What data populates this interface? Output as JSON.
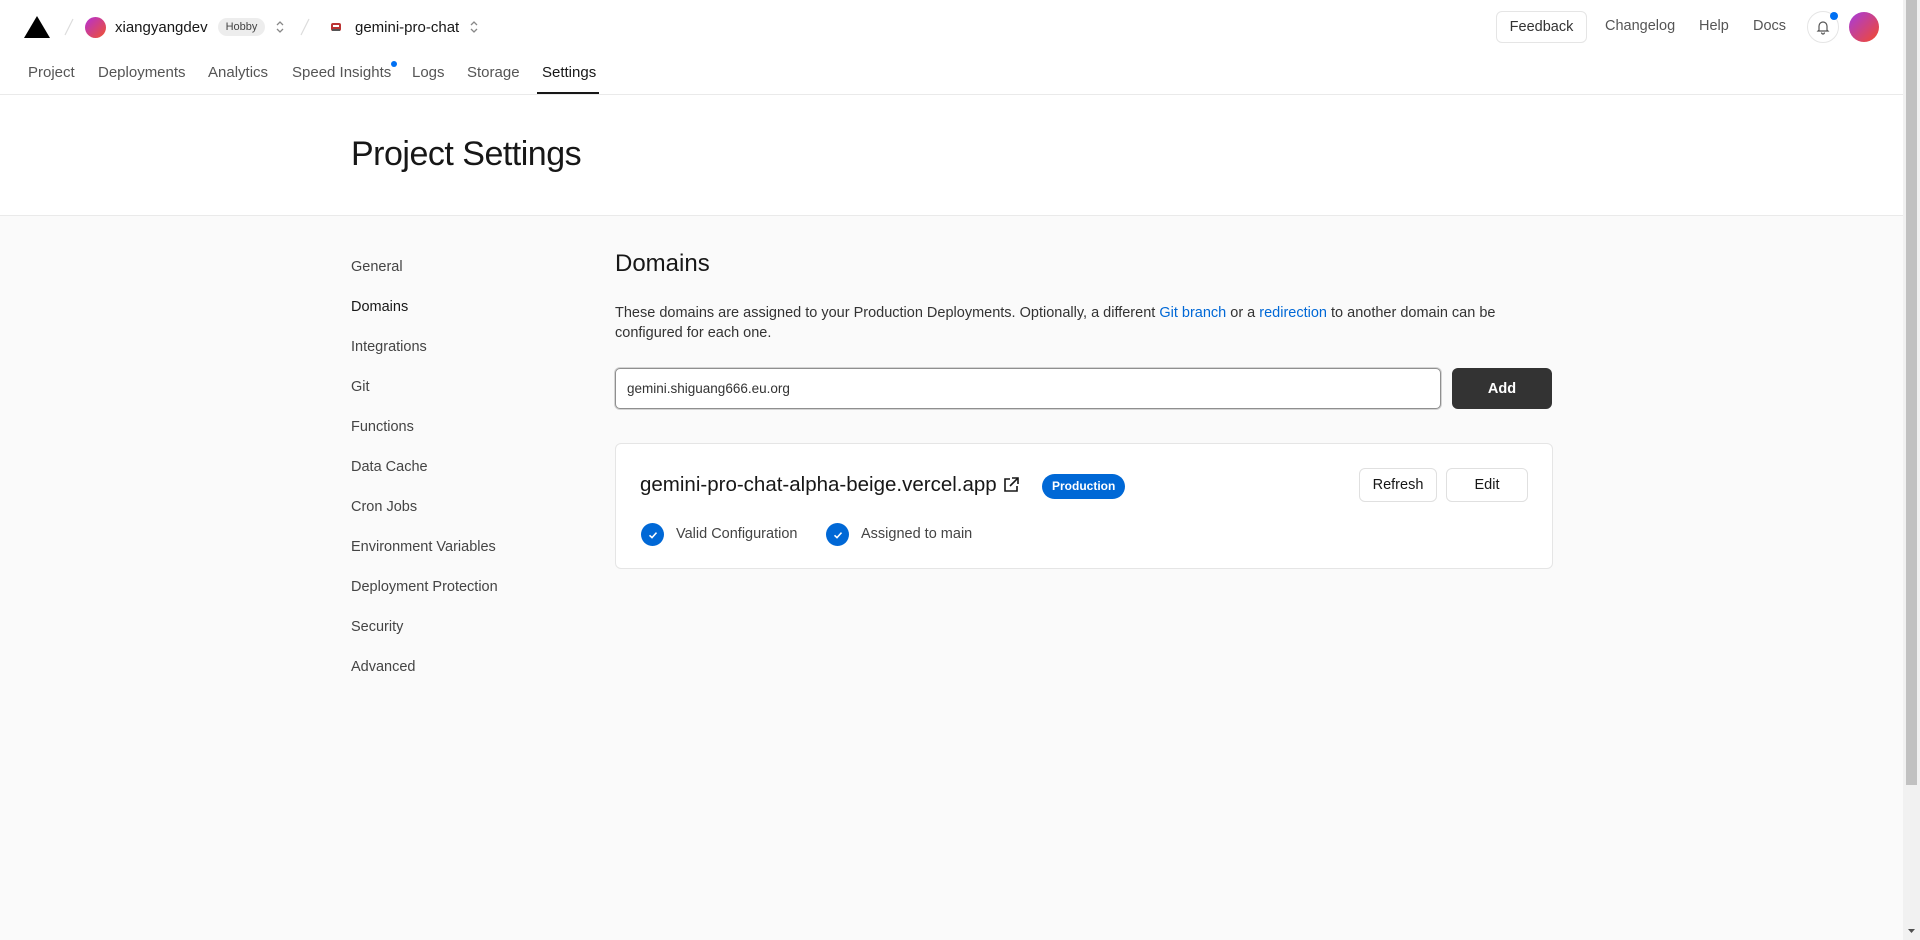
{
  "topbar": {
    "team_name": "xiangyangdev",
    "team_plan": "Hobby",
    "project_name": "gemini-pro-chat",
    "feedback_label": "Feedback",
    "changelog_label": "Changelog",
    "help_label": "Help",
    "docs_label": "Docs",
    "icons": [
      "vercel-logo-icon",
      "chevron-updown-icon",
      "project-icon",
      "bell-icon"
    ]
  },
  "nav": {
    "tabs": [
      {
        "label": "Project"
      },
      {
        "label": "Deployments"
      },
      {
        "label": "Analytics"
      },
      {
        "label": "Speed Insights"
      },
      {
        "label": "Logs"
      },
      {
        "label": "Storage"
      },
      {
        "label": "Settings"
      }
    ],
    "active": "Settings"
  },
  "page": {
    "title": "Project Settings"
  },
  "sidebar": {
    "items": [
      {
        "label": "General"
      },
      {
        "label": "Domains"
      },
      {
        "label": "Integrations"
      },
      {
        "label": "Git"
      },
      {
        "label": "Functions"
      },
      {
        "label": "Data Cache"
      },
      {
        "label": "Cron Jobs"
      },
      {
        "label": "Environment Variables"
      },
      {
        "label": "Deployment Protection"
      },
      {
        "label": "Security"
      },
      {
        "label": "Advanced"
      }
    ],
    "active": "Domains"
  },
  "domains": {
    "title": "Domains",
    "desc_part1": "These domains are assigned to your Production Deployments. Optionally, a different ",
    "desc_link1": "Git branch",
    "desc_part2": " or a ",
    "desc_link2": "redirection",
    "desc_part3": " to another domain can be configured for each one.",
    "input_value": "gemini.shiguang666.eu.org",
    "add_label": "Add",
    "card": {
      "domain": "gemini-pro-chat-alpha-beige.vercel.app",
      "badge": "Production",
      "refresh_label": "Refresh",
      "edit_label": "Edit",
      "status1": "Valid Configuration",
      "status2": "Assigned to main"
    }
  },
  "colors": {
    "accent": "#0068d6",
    "add_button": "#333333",
    "background": "#fafafa"
  }
}
